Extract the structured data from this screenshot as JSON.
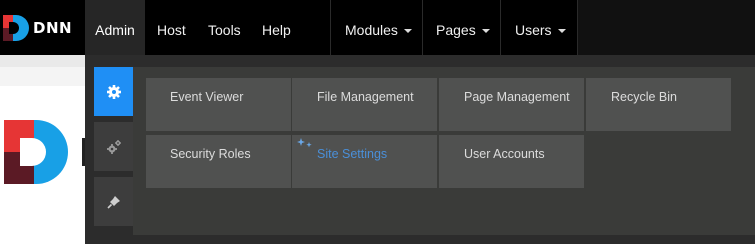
{
  "brand": {
    "name": "DNN"
  },
  "topnav": {
    "admin": "Admin",
    "host": "Host",
    "tools": "Tools",
    "help": "Help",
    "modules": "Modules",
    "pages": "Pages",
    "users": "Users"
  },
  "sidebar": [
    {
      "icon": "gear-icon",
      "active": true
    },
    {
      "icon": "gears-icon",
      "active": false
    },
    {
      "icon": "pin-icon",
      "active": false
    }
  ],
  "menu": {
    "items": [
      {
        "label": "Event Viewer"
      },
      {
        "label": "File Management"
      },
      {
        "label": "Page Management"
      },
      {
        "label": "Recycle Bin"
      },
      {
        "label": "Security Roles"
      },
      {
        "label": "Site Settings",
        "selected": true
      },
      {
        "label": "User Accounts"
      }
    ]
  },
  "colors": {
    "accent": "#1f8ff5",
    "selected_text": "#4a8fd8",
    "topbar": "#000000",
    "panel": "#2c2c2c",
    "tile": "#505150"
  }
}
